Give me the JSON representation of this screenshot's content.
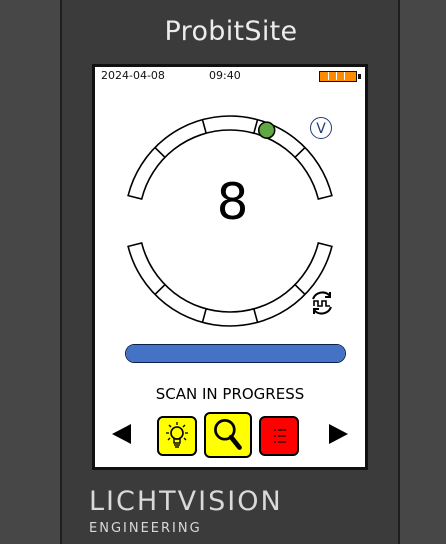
{
  "device": {
    "brand_title": "ProbitSite",
    "logo_main": "LICHTVISION",
    "logo_sub": "ENGINEERING"
  },
  "status_bar": {
    "date": "2024-04-08",
    "time": "09:40",
    "battery_level": 1.0,
    "battery_color": "#ff8c00"
  },
  "gauge": {
    "count": "8",
    "segments_upper": 5,
    "segments_lower": 5,
    "indicator_color": "#5fa843",
    "mode_badge": "V"
  },
  "progress": {
    "value": 1.0,
    "color": "#4472c4"
  },
  "message": "SCAN IN PROGRESS",
  "controls": {
    "prev_icon": "left-triangle-icon",
    "next_icon": "right-triangle-icon",
    "tiles": [
      {
        "icon": "lightbulb-icon",
        "color": "#ffff00"
      },
      {
        "icon": "magnifier-icon",
        "color": "#ffff00"
      },
      {
        "icon": "list-icon",
        "color": "#ff0000"
      }
    ]
  }
}
